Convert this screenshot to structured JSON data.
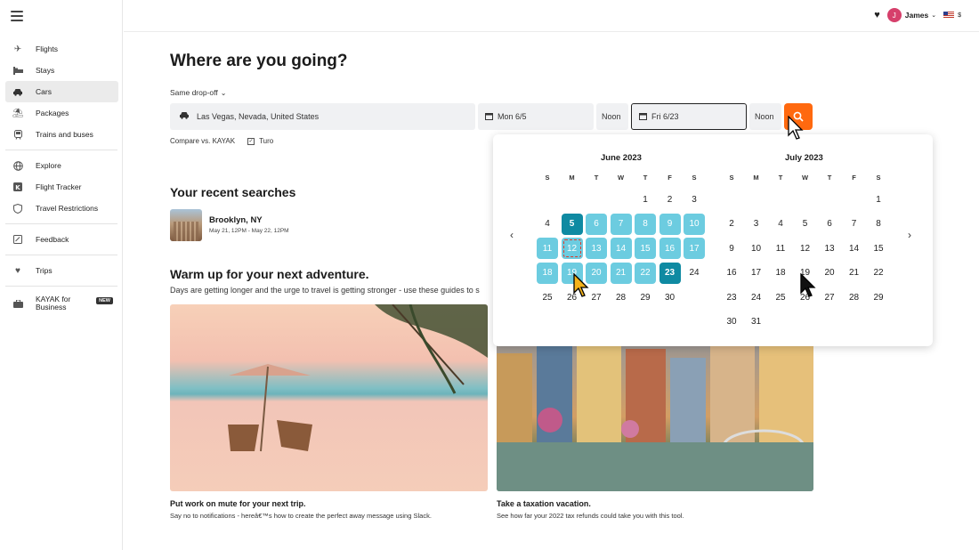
{
  "sidebar": {
    "items": [
      {
        "label": "Flights",
        "icon": "plane-icon"
      },
      {
        "label": "Stays",
        "icon": "bed-icon"
      },
      {
        "label": "Cars",
        "icon": "car-icon",
        "active": true
      },
      {
        "label": "Packages",
        "icon": "umbrella-icon"
      },
      {
        "label": "Trains and buses",
        "icon": "train-icon"
      }
    ],
    "items2": [
      {
        "label": "Explore",
        "icon": "globe-icon"
      },
      {
        "label": "Flight Tracker",
        "icon": "flight-tracker-icon"
      },
      {
        "label": "Travel Restrictions",
        "icon": "shield-icon"
      }
    ],
    "feedback": "Feedback",
    "trips": "Trips",
    "business_line1": "KAYAK for",
    "business_line2": "Business",
    "new_badge": "NEW"
  },
  "header": {
    "user_initial": "J",
    "user_name": "James",
    "currency": "$"
  },
  "main": {
    "title": "Where are you going?",
    "dropoff_label": "Same drop-off",
    "location": "Las Vegas, Nevada, United States",
    "pickup_date": "Mon 6/5",
    "pickup_time": "Noon",
    "dropoff_date": "Fri 6/23",
    "dropoff_time": "Noon",
    "compare_label": "Compare vs. KAYAK",
    "compare_option": "Turo",
    "recent_title": "Your recent searches",
    "recent_place": "Brooklyn, NY",
    "recent_dates": "May 21, 12PM - May 22, 12PM",
    "warmup_title": "Warm up for your next adventure.",
    "warmup_sub": "Days are getting longer and the urge to travel is getting stronger - use these guides to s",
    "card1_title": "Put work on mute for your next trip.",
    "card1_desc": "Say no to notifications - hereâ€™s how to create the perfect away message using Slack.",
    "card2_title": "Take a taxation vacation.",
    "card2_desc": "See how far your 2022 tax refunds could take you with this tool."
  },
  "calendar": {
    "dow": [
      "S",
      "M",
      "T",
      "W",
      "T",
      "F",
      "S"
    ],
    "months": [
      {
        "title": "June 2023",
        "first_dow": 4,
        "days": 30,
        "range_start": 5,
        "range_end": 23,
        "focus": 12
      },
      {
        "title": "July 2023",
        "first_dow": 6,
        "days": 31
      }
    ],
    "accent": "#0f8aa2",
    "range_color": "#6ccce0"
  },
  "colors": {
    "search_button": "#ff690f",
    "avatar": "#d63f6b"
  }
}
